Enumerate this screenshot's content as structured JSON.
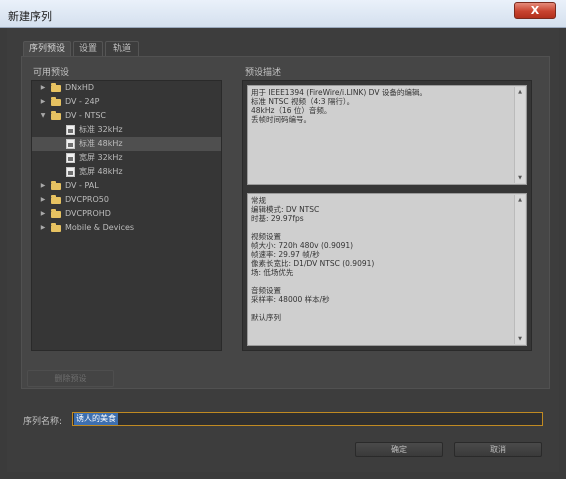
{
  "window": {
    "title": "新建序列",
    "close_label": "X"
  },
  "tabs": [
    {
      "label": "序列预设"
    },
    {
      "label": "设置"
    },
    {
      "label": "轨道"
    }
  ],
  "available_presets": {
    "label": "可用预设",
    "tree": [
      {
        "label": "DNxHD",
        "type": "folder",
        "expanded": false,
        "selected": false
      },
      {
        "label": "DV - 24P",
        "type": "folder",
        "expanded": false,
        "selected": false
      },
      {
        "label": "DV - NTSC",
        "type": "folder",
        "expanded": true,
        "selected": false
      },
      {
        "label": "标准 32kHz",
        "type": "preset",
        "selected": false
      },
      {
        "label": "标准 48kHz",
        "type": "preset",
        "selected": true
      },
      {
        "label": "宽屏 32kHz",
        "type": "preset",
        "selected": false
      },
      {
        "label": "宽屏 48kHz",
        "type": "preset",
        "selected": false
      },
      {
        "label": "DV - PAL",
        "type": "folder",
        "expanded": false,
        "selected": false
      },
      {
        "label": "DVCPRO50",
        "type": "folder",
        "expanded": false,
        "selected": false
      },
      {
        "label": "DVCPROHD",
        "type": "folder",
        "expanded": false,
        "selected": false
      },
      {
        "label": "Mobile & Devices",
        "type": "folder",
        "expanded": false,
        "selected": false
      }
    ],
    "delete_button": "删除预设"
  },
  "preset_description": {
    "label": "预设描述",
    "summary_lines": [
      "用于 IEEE1394 (FireWire/i.LINK) DV 设备的编辑。",
      "标准 NTSC 视频（4:3 隔行）。",
      "48kHz（16 位）音频。",
      "丢帧时间码编号。"
    ],
    "details_lines": [
      "常规",
      " 编辑模式: DV NTSC",
      " 时基: 29.97fps",
      "",
      "视频设置",
      " 帧大小: 720h 480v (0.9091)",
      " 帧速率: 29.97 帧/秒",
      " 像素长宽比: D1/DV NTSC (0.9091)",
      " 场: 低场优先",
      "",
      "音频设置",
      " 采样率: 48000 样本/秒",
      "",
      "默认序列"
    ]
  },
  "sequence_name": {
    "label": "序列名称:",
    "value": "诱人的美食"
  },
  "buttons": {
    "ok": "确定",
    "cancel": "取消"
  },
  "colors": {
    "accent_border": "#c08a22",
    "selection": "#3d6fb0",
    "folder": "#e7c261"
  }
}
